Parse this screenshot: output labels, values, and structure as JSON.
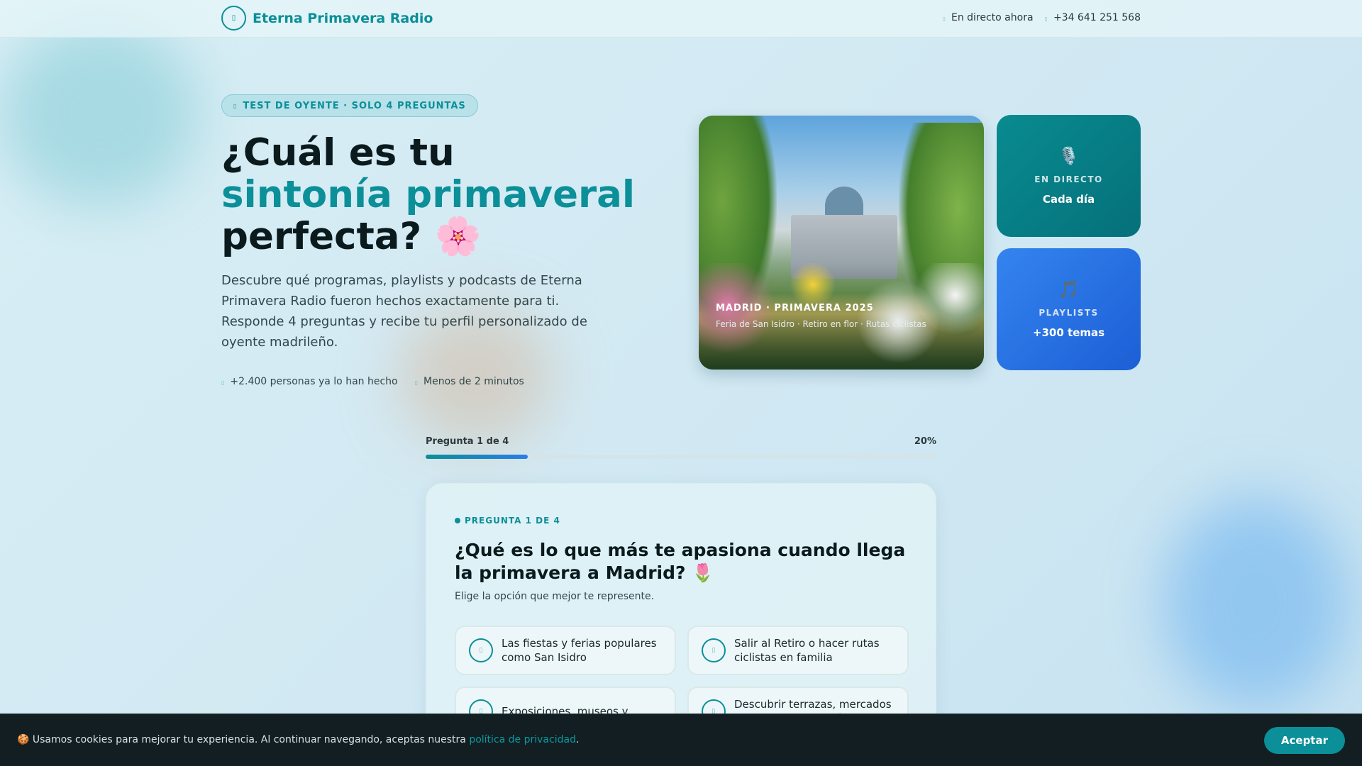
{
  "header": {
    "brand": "Eterna Primavera Radio",
    "live": "En directo ahora",
    "phone": "+34 641 251 568"
  },
  "hero": {
    "badge": "TEST DE OYENTE · SOLO 4 PREGUNTAS",
    "title_1": "¿Cuál es tu",
    "title_accent": "sintonía primaveral",
    "title_2": "perfecta? 🌸",
    "description": "Descubre qué programas, playlists y podcasts de Eterna Primavera Radio fueron hechos exactamente para ti. Responde 4 preguntas y recibe tu perfil personalizado de oyente madrileño.",
    "stats": [
      "+2.400 personas ya lo han hecho",
      "Menos de 2 minutos"
    ],
    "image_caption_title": "MADRID · PRIMAVERA 2025",
    "image_caption_sub": "Feria de San Isidro · Retiro en flor · Rutas ciclistas",
    "cards": [
      {
        "icon": "🎙️",
        "label": "EN DIRECTO",
        "value": "Cada día"
      },
      {
        "icon": "🎵",
        "label": "PLAYLISTS",
        "value": "+300 temas"
      }
    ]
  },
  "progress": {
    "label": "Pregunta 1 de 4",
    "percent_label": "20%",
    "percent": 20
  },
  "question": {
    "tag": "PREGUNTA 1 DE 4",
    "title": "¿Qué es lo que más te apasiona cuando llega la primavera a Madrid? 🌷",
    "subtitle": "Elige la opción que mejor te represente.",
    "options": [
      "Las fiestas y ferias populares como San Isidro",
      "Salir al Retiro o hacer rutas ciclistas en familia",
      "Exposiciones, museos y",
      "Descubrir terrazas, mercados y nueva gastronomía"
    ]
  },
  "cookie": {
    "icon": "🍪",
    "text": "Usamos cookies para mejorar tu experiencia. Al continuar navegando, aceptas nuestra ",
    "link": "política de privacidad",
    "end": ".",
    "accept": "Aceptar"
  }
}
